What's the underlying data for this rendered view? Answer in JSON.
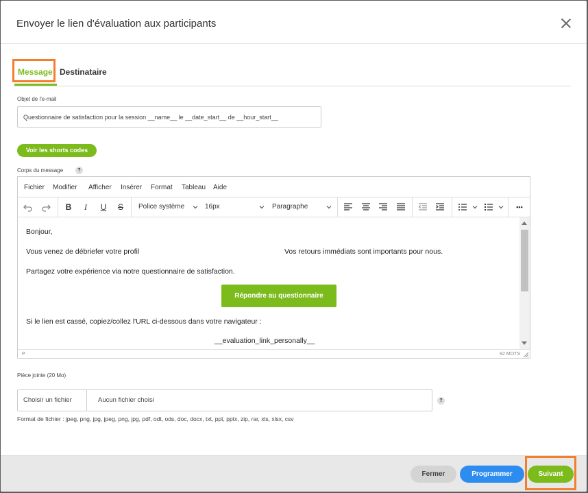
{
  "modal": {
    "title": "Envoyer le lien d'évaluation aux participants"
  },
  "tabs": [
    {
      "label": "Message",
      "active": true
    },
    {
      "label": "Destinataire",
      "active": false
    }
  ],
  "subject": {
    "label": "Objet de l'e-mail",
    "value": "Questionnaire de satisfaction pour la session __name__ le __date_start__ de __hour_start__"
  },
  "shortcodes_button": "Voir les shorts codes",
  "body": {
    "label": "Corps du message",
    "help": "?",
    "menu": [
      "Fichier",
      "Modifier",
      "Afficher",
      "Insérer",
      "Format",
      "Tableau",
      "Aide"
    ],
    "toolbar": {
      "font_family": "Police système",
      "font_size": "16px",
      "block": "Paragraphe",
      "bold": "B",
      "italic": "I",
      "underline": "U",
      "strike": "S",
      "more": "•••"
    },
    "content": {
      "greeting": "Bonjour,",
      "line1_left": "Vous venez de débriefer votre profil",
      "line1_right": "Vos retours immédiats sont importants pour nous.",
      "line2": "Partagez votre expérience  via notre questionnaire de satisfaction.",
      "cta": "Répondre au questionnaire",
      "line3": "Si le lien est cassé, copiez/collez l'URL ci-dessous dans votre navigateur :",
      "link": "__evaluation_link_personally__"
    },
    "status_path": "P",
    "word_count": "92 MOTS"
  },
  "attachment": {
    "label": "Pièce jointe (20 Mo)",
    "choose": "Choisir un fichier",
    "none": "Aucun fichier choisi",
    "help": "?",
    "formats": "Format de fichier : jpeg, png, jpg, jpeg, png, jpg, pdf, odt, ods, doc, docx, txt, ppt, pptx, zip, rar, xls, xlsx, csv"
  },
  "footer": {
    "close": "Fermer",
    "schedule": "Programmer",
    "next": "Suivant"
  },
  "colors": {
    "accent_green": "#7cbb1c",
    "blue": "#2d8cf0",
    "highlight_orange": "#f47e30"
  }
}
